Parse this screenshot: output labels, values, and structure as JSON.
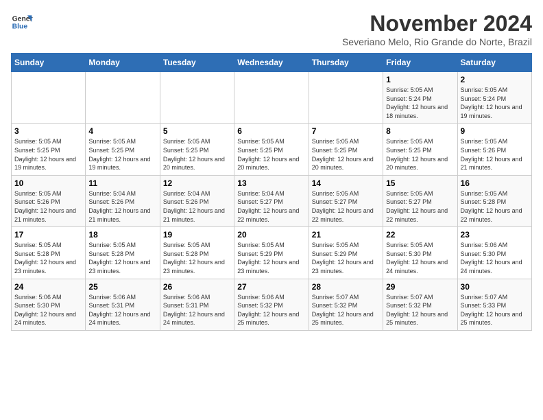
{
  "header": {
    "logo_line1": "General",
    "logo_line2": "Blue",
    "month": "November 2024",
    "location": "Severiano Melo, Rio Grande do Norte, Brazil"
  },
  "weekdays": [
    "Sunday",
    "Monday",
    "Tuesday",
    "Wednesday",
    "Thursday",
    "Friday",
    "Saturday"
  ],
  "weeks": [
    [
      {
        "day": "",
        "info": ""
      },
      {
        "day": "",
        "info": ""
      },
      {
        "day": "",
        "info": ""
      },
      {
        "day": "",
        "info": ""
      },
      {
        "day": "",
        "info": ""
      },
      {
        "day": "1",
        "info": "Sunrise: 5:05 AM\nSunset: 5:24 PM\nDaylight: 12 hours and 18 minutes."
      },
      {
        "day": "2",
        "info": "Sunrise: 5:05 AM\nSunset: 5:24 PM\nDaylight: 12 hours and 19 minutes."
      }
    ],
    [
      {
        "day": "3",
        "info": "Sunrise: 5:05 AM\nSunset: 5:25 PM\nDaylight: 12 hours and 19 minutes."
      },
      {
        "day": "4",
        "info": "Sunrise: 5:05 AM\nSunset: 5:25 PM\nDaylight: 12 hours and 19 minutes."
      },
      {
        "day": "5",
        "info": "Sunrise: 5:05 AM\nSunset: 5:25 PM\nDaylight: 12 hours and 20 minutes."
      },
      {
        "day": "6",
        "info": "Sunrise: 5:05 AM\nSunset: 5:25 PM\nDaylight: 12 hours and 20 minutes."
      },
      {
        "day": "7",
        "info": "Sunrise: 5:05 AM\nSunset: 5:25 PM\nDaylight: 12 hours and 20 minutes."
      },
      {
        "day": "8",
        "info": "Sunrise: 5:05 AM\nSunset: 5:25 PM\nDaylight: 12 hours and 20 minutes."
      },
      {
        "day": "9",
        "info": "Sunrise: 5:05 AM\nSunset: 5:26 PM\nDaylight: 12 hours and 21 minutes."
      }
    ],
    [
      {
        "day": "10",
        "info": "Sunrise: 5:05 AM\nSunset: 5:26 PM\nDaylight: 12 hours and 21 minutes."
      },
      {
        "day": "11",
        "info": "Sunrise: 5:04 AM\nSunset: 5:26 PM\nDaylight: 12 hours and 21 minutes."
      },
      {
        "day": "12",
        "info": "Sunrise: 5:04 AM\nSunset: 5:26 PM\nDaylight: 12 hours and 21 minutes."
      },
      {
        "day": "13",
        "info": "Sunrise: 5:04 AM\nSunset: 5:27 PM\nDaylight: 12 hours and 22 minutes."
      },
      {
        "day": "14",
        "info": "Sunrise: 5:05 AM\nSunset: 5:27 PM\nDaylight: 12 hours and 22 minutes."
      },
      {
        "day": "15",
        "info": "Sunrise: 5:05 AM\nSunset: 5:27 PM\nDaylight: 12 hours and 22 minutes."
      },
      {
        "day": "16",
        "info": "Sunrise: 5:05 AM\nSunset: 5:28 PM\nDaylight: 12 hours and 22 minutes."
      }
    ],
    [
      {
        "day": "17",
        "info": "Sunrise: 5:05 AM\nSunset: 5:28 PM\nDaylight: 12 hours and 23 minutes."
      },
      {
        "day": "18",
        "info": "Sunrise: 5:05 AM\nSunset: 5:28 PM\nDaylight: 12 hours and 23 minutes."
      },
      {
        "day": "19",
        "info": "Sunrise: 5:05 AM\nSunset: 5:28 PM\nDaylight: 12 hours and 23 minutes."
      },
      {
        "day": "20",
        "info": "Sunrise: 5:05 AM\nSunset: 5:29 PM\nDaylight: 12 hours and 23 minutes."
      },
      {
        "day": "21",
        "info": "Sunrise: 5:05 AM\nSunset: 5:29 PM\nDaylight: 12 hours and 23 minutes."
      },
      {
        "day": "22",
        "info": "Sunrise: 5:05 AM\nSunset: 5:30 PM\nDaylight: 12 hours and 24 minutes."
      },
      {
        "day": "23",
        "info": "Sunrise: 5:06 AM\nSunset: 5:30 PM\nDaylight: 12 hours and 24 minutes."
      }
    ],
    [
      {
        "day": "24",
        "info": "Sunrise: 5:06 AM\nSunset: 5:30 PM\nDaylight: 12 hours and 24 minutes."
      },
      {
        "day": "25",
        "info": "Sunrise: 5:06 AM\nSunset: 5:31 PM\nDaylight: 12 hours and 24 minutes."
      },
      {
        "day": "26",
        "info": "Sunrise: 5:06 AM\nSunset: 5:31 PM\nDaylight: 12 hours and 24 minutes."
      },
      {
        "day": "27",
        "info": "Sunrise: 5:06 AM\nSunset: 5:32 PM\nDaylight: 12 hours and 25 minutes."
      },
      {
        "day": "28",
        "info": "Sunrise: 5:07 AM\nSunset: 5:32 PM\nDaylight: 12 hours and 25 minutes."
      },
      {
        "day": "29",
        "info": "Sunrise: 5:07 AM\nSunset: 5:32 PM\nDaylight: 12 hours and 25 minutes."
      },
      {
        "day": "30",
        "info": "Sunrise: 5:07 AM\nSunset: 5:33 PM\nDaylight: 12 hours and 25 minutes."
      }
    ]
  ]
}
